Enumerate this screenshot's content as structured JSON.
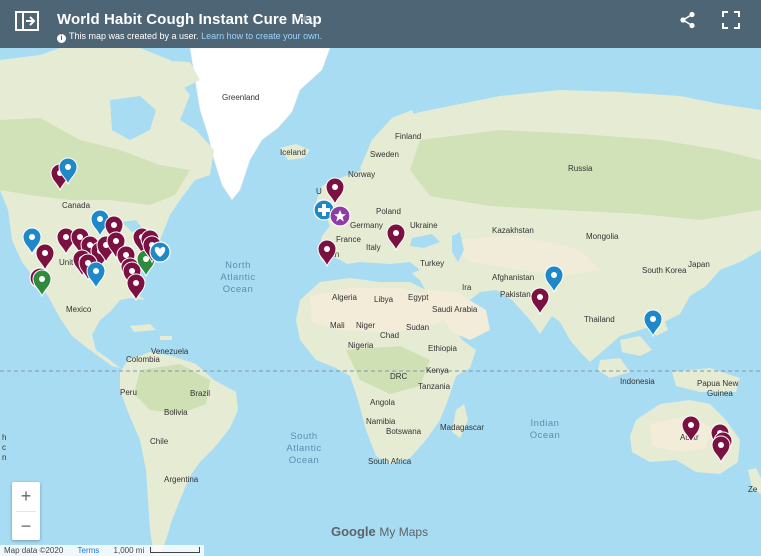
{
  "header": {
    "title": "World Habit Cough Instant Cure Map",
    "star_icon": "star-icon",
    "subtitle_text": "This map was created by a user.",
    "subtitle_link": "Learn how to create your own."
  },
  "labels": {
    "greenland": "Greenland",
    "iceland": "Iceland",
    "finland": "Finland",
    "sweden": "Sweden",
    "norway": "Norway",
    "russia": "Russia",
    "canada": "Canada",
    "poland": "Poland",
    "germany": "Germany",
    "ukraine": "Ukraine",
    "france": "France",
    "italy": "Italy",
    "kazakhstan": "Kazakhstan",
    "mongolia": "Mongolia",
    "united_kingdom_frag": "U",
    "spain_frag": "in",
    "turkey": "Turkey",
    "united_states_frag": "Unite",
    "south_korea": "South Korea",
    "japan": "Japan",
    "afghanistan": "Afghanistan",
    "pakistan": "Pakistan",
    "iran_frag": "Ira",
    "algeria": "Algeria",
    "libya": "Libya",
    "egypt": "Egypt",
    "saudi_arabia": "Saudi Arabia",
    "mexico": "Mexico",
    "thailand": "Thailand",
    "mali": "Mali",
    "niger": "Niger",
    "chad": "Chad",
    "sudan": "Sudan",
    "nigeria": "Nigeria",
    "ethiopia": "Ethiopia",
    "venezuela": "Venezuela",
    "colombia": "Colombia",
    "drc": "DRC",
    "kenya": "Kenya",
    "tanzania": "Tanzania",
    "indonesia": "Indonesia",
    "papua_new_guinea_1": "Papua New",
    "papua_new_guinea_2": "Guinea",
    "peru": "Peru",
    "brazil": "Brazil",
    "bolivia": "Bolivia",
    "angola": "Angola",
    "namibia": "Namibia",
    "botswana": "Botswana",
    "madagascar": "Madagascar",
    "south_africa": "South Africa",
    "chile": "Chile",
    "argentina": "Argentina",
    "australia_frag": "Austr",
    "nz_frag": "Ze",
    "north_atlantic_1": "North",
    "north_atlantic_2": "Atlantic",
    "north_atlantic_3": "Ocean",
    "south_atlantic_1": "South",
    "south_atlantic_2": "Atlantic",
    "south_atlantic_3": "Ocean",
    "indian_1": "Indian",
    "indian_2": "Ocean",
    "left_edge_1": "h",
    "left_edge_2": "c",
    "left_edge_3": "n"
  },
  "colors": {
    "water": "#a8dcf2",
    "land": "#e6ecd4",
    "forest": "#bfd9a0",
    "desert": "#f2ecd9",
    "ice": "#ffffff",
    "header": "#4d6574",
    "pin_maroon": "#7b1141",
    "pin_blue": "#1e88c9",
    "pin_purple": "#8e3da6",
    "pin_green": "#2e8b3e"
  },
  "markers": [
    {
      "icon": "pin",
      "color": "maroon",
      "region": "Canada west"
    },
    {
      "icon": "pin",
      "color": "blue",
      "region": "Canada west"
    },
    {
      "icon": "pin",
      "color": "blue",
      "region": "USA northwest"
    },
    {
      "icon": "pin",
      "color": "blue",
      "region": "USA north-central"
    },
    {
      "icon": "pin",
      "color": "maroon",
      "region": "USA west"
    },
    {
      "icon": "pin",
      "color": "maroon",
      "region": "USA west"
    },
    {
      "icon": "cross",
      "color": "maroon",
      "region": "California"
    },
    {
      "icon": "pin",
      "color": "green",
      "region": "California"
    },
    {
      "icon": "pin",
      "color": "maroon",
      "region": "USA central"
    },
    {
      "icon": "pin",
      "color": "maroon",
      "region": "USA central"
    },
    {
      "icon": "pin",
      "color": "maroon",
      "region": "USA central"
    },
    {
      "icon": "pin",
      "color": "maroon",
      "region": "USA central"
    },
    {
      "icon": "pin",
      "color": "maroon",
      "region": "USA central"
    },
    {
      "icon": "pin",
      "color": "maroon",
      "region": "USA central"
    },
    {
      "icon": "pin",
      "color": "blue",
      "region": "USA south"
    },
    {
      "icon": "pin",
      "color": "maroon",
      "region": "USA south"
    },
    {
      "icon": "pin",
      "color": "maroon",
      "region": "USA south"
    },
    {
      "icon": "pin",
      "color": "maroon",
      "region": "USA south"
    },
    {
      "icon": "pin",
      "color": "maroon",
      "region": "USA south"
    },
    {
      "icon": "pin",
      "color": "maroon",
      "region": "USA east"
    },
    {
      "icon": "pin",
      "color": "maroon",
      "region": "USA east"
    },
    {
      "icon": "pin",
      "color": "green",
      "region": "USA east"
    },
    {
      "icon": "pin",
      "color": "maroon",
      "region": "USA east"
    },
    {
      "icon": "heart",
      "color": "blue",
      "region": "USA northeast"
    },
    {
      "icon": "pin",
      "color": "maroon",
      "region": "USA east"
    },
    {
      "icon": "pin",
      "color": "maroon",
      "region": "Florida"
    },
    {
      "icon": "pin",
      "color": "maroon",
      "region": "UK"
    },
    {
      "icon": "cross",
      "color": "blue",
      "region": "UK"
    },
    {
      "icon": "star",
      "color": "purple",
      "region": "UK"
    },
    {
      "icon": "pin",
      "color": "maroon",
      "region": "Spain"
    },
    {
      "icon": "pin",
      "color": "maroon",
      "region": "Balkans"
    },
    {
      "icon": "pin",
      "color": "blue",
      "region": "Nepal"
    },
    {
      "icon": "pin",
      "color": "maroon",
      "region": "India"
    },
    {
      "icon": "pin",
      "color": "blue",
      "region": "Philippines"
    },
    {
      "icon": "pin",
      "color": "maroon",
      "region": "Australia"
    },
    {
      "icon": "pin",
      "color": "maroon",
      "region": "Australia east"
    },
    {
      "icon": "pin",
      "color": "maroon",
      "region": "Australia east"
    },
    {
      "icon": "pin",
      "color": "maroon",
      "region": "Australia east"
    }
  ],
  "controls": {
    "zoom_in": "+",
    "zoom_out": "−"
  },
  "branding": {
    "google": "Google",
    "my_maps": "My Maps"
  },
  "footer": {
    "map_data": "Map data ©2020",
    "terms": "Terms",
    "scale": "1,000 mi"
  }
}
